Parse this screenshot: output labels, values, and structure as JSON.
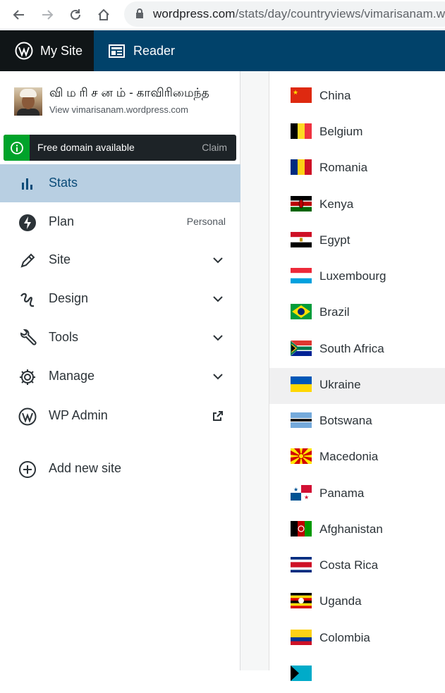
{
  "browser": {
    "url_domain": "wordpress.com",
    "url_path": "/stats/day/countryviews/vimarisanam.w"
  },
  "masterbar": {
    "my_site": "My Site",
    "reader": "Reader"
  },
  "site": {
    "title": "வி ம ரி ச ன ம் - காவிரிமைந்த",
    "url": "View vimarisanam.wordpress.com"
  },
  "domain_notice": {
    "text": "Free domain available",
    "action": "Claim"
  },
  "menu": [
    {
      "label": "Stats",
      "icon": "stats-icon",
      "active": true
    },
    {
      "label": "Plan",
      "icon": "plan-icon",
      "right": "Personal"
    },
    {
      "label": "Site",
      "icon": "pencil-icon",
      "chevron": true
    },
    {
      "label": "Design",
      "icon": "design-icon",
      "chevron": true
    },
    {
      "label": "Tools",
      "icon": "wrench-icon",
      "chevron": true
    },
    {
      "label": "Manage",
      "icon": "gear-icon",
      "chevron": true
    },
    {
      "label": "WP Admin",
      "icon": "wordpress-icon",
      "external": true
    },
    {
      "label": "Add new site",
      "icon": "add-circle-icon"
    }
  ],
  "countries": [
    {
      "name": "China",
      "flag": "china-flag-icon"
    },
    {
      "name": "Belgium",
      "flag": "belgium-flag-icon"
    },
    {
      "name": "Romania",
      "flag": "romania-flag-icon"
    },
    {
      "name": "Kenya",
      "flag": "kenya-flag-icon"
    },
    {
      "name": "Egypt",
      "flag": "egypt-flag-icon"
    },
    {
      "name": "Luxembourg",
      "flag": "luxembourg-flag-icon"
    },
    {
      "name": "Brazil",
      "flag": "brazil-flag-icon"
    },
    {
      "name": "South Africa",
      "flag": "south-africa-flag-icon"
    },
    {
      "name": "Ukraine",
      "flag": "ukraine-flag-icon"
    },
    {
      "name": "Botswana",
      "flag": "botswana-flag-icon"
    },
    {
      "name": "Macedonia",
      "flag": "macedonia-flag-icon"
    },
    {
      "name": "Panama",
      "flag": "panama-flag-icon"
    },
    {
      "name": "Afghanistan",
      "flag": "afghanistan-flag-icon"
    },
    {
      "name": "Costa Rica",
      "flag": "costa-rica-flag-icon"
    },
    {
      "name": "Uganda",
      "flag": "uganda-flag-icon"
    },
    {
      "name": "Colombia",
      "flag": "colombia-flag-icon"
    }
  ],
  "colors": {
    "masterbar": "#01426a",
    "active_menu": "#b8cfe2",
    "notice_green": "#00a32a"
  }
}
